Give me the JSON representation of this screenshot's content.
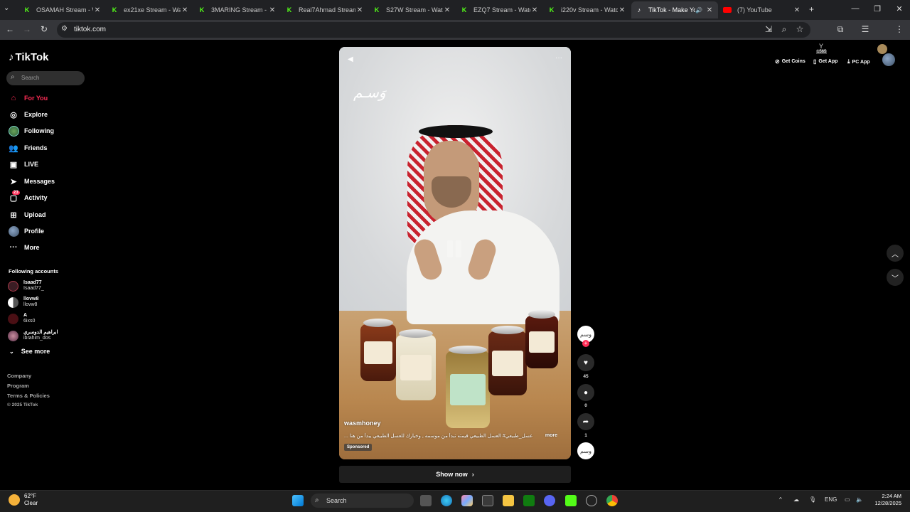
{
  "browser": {
    "tabs": [
      {
        "title": "OSAMAH Stream - W",
        "favicon": "kick-icon"
      },
      {
        "title": "ex21xe Stream - Wat",
        "favicon": "kick-icon"
      },
      {
        "title": "3MARING Stream - W",
        "favicon": "kick-icon"
      },
      {
        "title": "Real7Ahmad Stream",
        "favicon": "kick-icon"
      },
      {
        "title": "S27W Stream - Watc",
        "favicon": "kick-icon"
      },
      {
        "title": "EZQ7 Stream - Watch",
        "favicon": "kick-icon"
      },
      {
        "title": "i220v Stream - Watch",
        "favicon": "kick-icon"
      },
      {
        "title": "TikTok - Make Yo",
        "favicon": "tiktok-icon",
        "active": true
      },
      {
        "title": "(7) YouTube",
        "favicon": "youtube-icon"
      }
    ],
    "url": "tiktok.com",
    "extension_badge": "1565"
  },
  "sidebar": {
    "logo": "TikTok",
    "search_placeholder": "Search",
    "nav": [
      {
        "label": "For You",
        "icon": "home-icon",
        "active": true
      },
      {
        "label": "Explore",
        "icon": "compass-icon"
      },
      {
        "label": "Following",
        "icon": "following-avatar-icon"
      },
      {
        "label": "Friends",
        "icon": "friends-icon"
      },
      {
        "label": "LIVE",
        "icon": "live-icon"
      },
      {
        "label": "Messages",
        "icon": "messages-icon"
      },
      {
        "label": "Activity",
        "icon": "activity-icon",
        "badge": "23"
      },
      {
        "label": "Upload",
        "icon": "upload-icon"
      },
      {
        "label": "Profile",
        "icon": "profile-avatar-icon"
      },
      {
        "label": "More",
        "icon": "more-icon"
      }
    ],
    "following_header": "Following accounts",
    "following": [
      {
        "name": "Isaad77",
        "handle": "Isaad77_"
      },
      {
        "name": "llovw8",
        "handle": "llovw8"
      },
      {
        "name": "A",
        "handle": "6ixs0"
      },
      {
        "name": "ابراهيم الدوسري",
        "handle": "ibrahim_dos"
      }
    ],
    "see_more": "See more",
    "footer": [
      "Company",
      "Program",
      "Terms & Policies",
      "© 2025 TikTok"
    ]
  },
  "video": {
    "username": "wasmhoney",
    "caption": "عسل_طبيعي# العسل الطبيعي قيمته تبدأ من موسمه , وخيارك للعسل الطبيعي يبدأ من هنا ...",
    "more_label": "more",
    "sponsored_label": "Sponsored",
    "brand_mark": "وَسـم",
    "cta": "Show now"
  },
  "actions": {
    "likes": "45",
    "comments": "0",
    "shares": "1"
  },
  "topbar": {
    "get_coins": "Get Coins",
    "get_app": "Get App",
    "pc_app": "PC App"
  },
  "taskbar": {
    "weather_temp": "62°F",
    "weather_desc": "Clear",
    "search_placeholder": "Search",
    "lang": "ENG",
    "time": "2:24 AM",
    "date": "12/28/2025"
  },
  "colors": {
    "tiktok_red": "#fe2c55",
    "kick_green": "#53fc18"
  }
}
